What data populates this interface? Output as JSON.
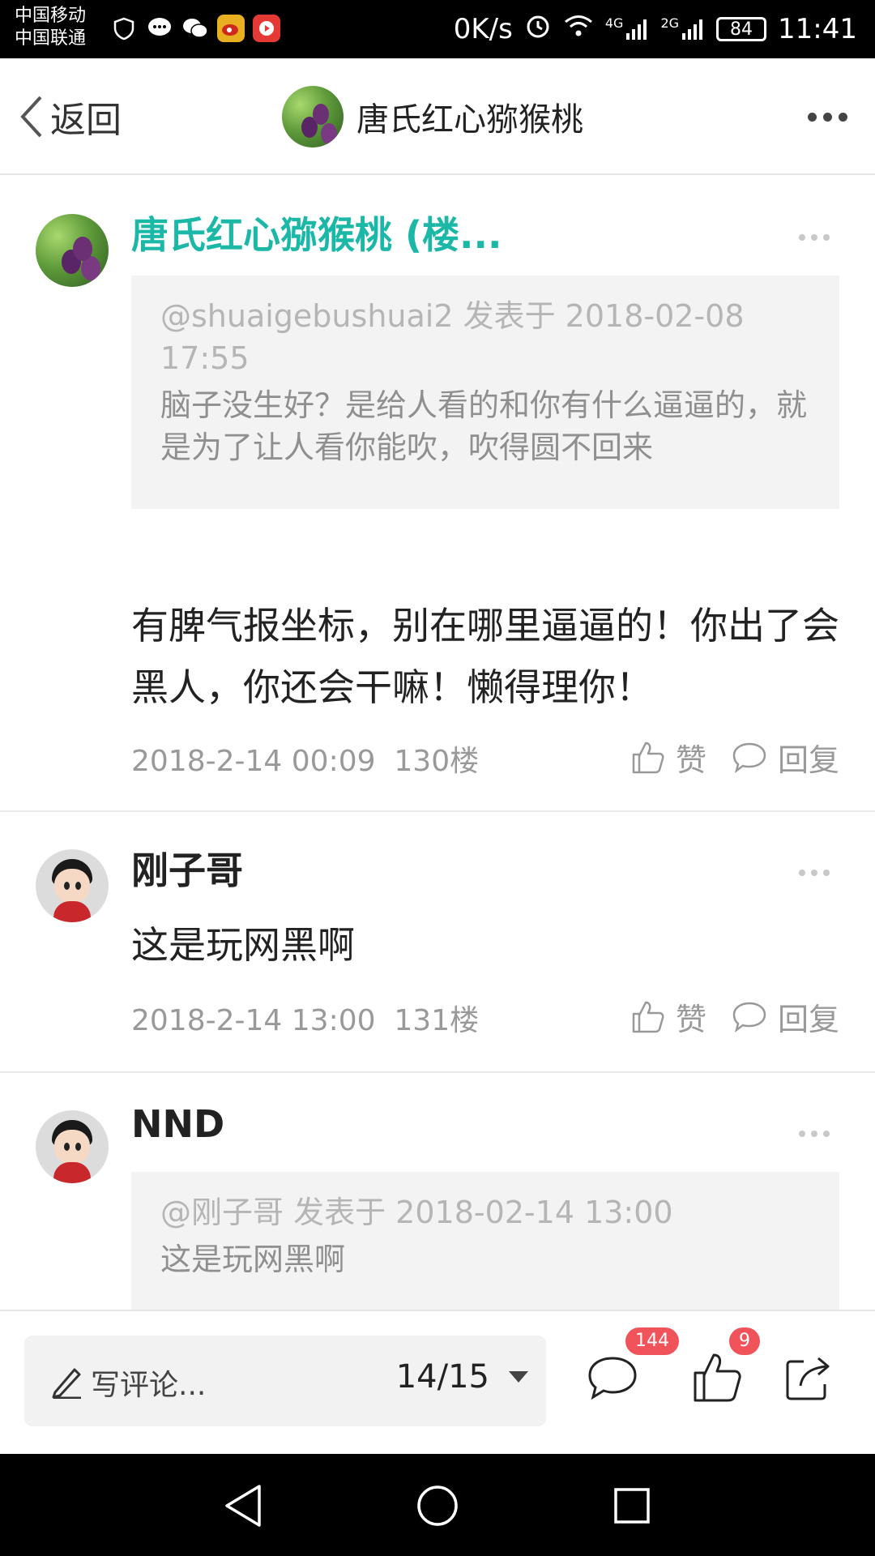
{
  "status_bar": {
    "carrier_1": "中国移动",
    "carrier_2": "中国联通",
    "net_speed": "0K/s",
    "net_4g": "4G",
    "net_2g": "2G",
    "battery": "84",
    "time": "11:41"
  },
  "header": {
    "back_label": "返回",
    "title": "唐氏红心猕猴桃"
  },
  "posts": [
    {
      "author": "唐氏红心猕猴桃 (楼...",
      "author_color": "#1bb7a7",
      "quote_meta": "@shuaigebushuai2 发表于 2018-02-08 17:55",
      "quote_text": "脑子没生好？是给人看的和你有什么逼逼的，就是为了让人看你能吹，吹得圆不回来",
      "body": "有脾气报坐标，别在哪里逼逼的！你出了会黑人，你还会干嘛！懒得理你！",
      "date": "2018-2-14 00:09",
      "floor": "130楼",
      "like_label": "赞",
      "reply_label": "回复"
    },
    {
      "author": "刚子哥",
      "body": "这是玩网黑啊",
      "date": "2018-2-14 13:00",
      "floor": "131楼",
      "like_label": "赞",
      "reply_label": "回复"
    },
    {
      "author": "NND",
      "quote_meta": "@刚子哥 发表于 2018-02-14 13:00",
      "quote_text": "这是玩网黑啊"
    }
  ],
  "bottom_bar": {
    "comment_placeholder": "写评论...",
    "page_indicator": "14/15",
    "comment_count": "144",
    "like_count": "9"
  },
  "colors": {
    "accent_teal": "#1bb7a7",
    "badge_red": "#f0545a"
  }
}
